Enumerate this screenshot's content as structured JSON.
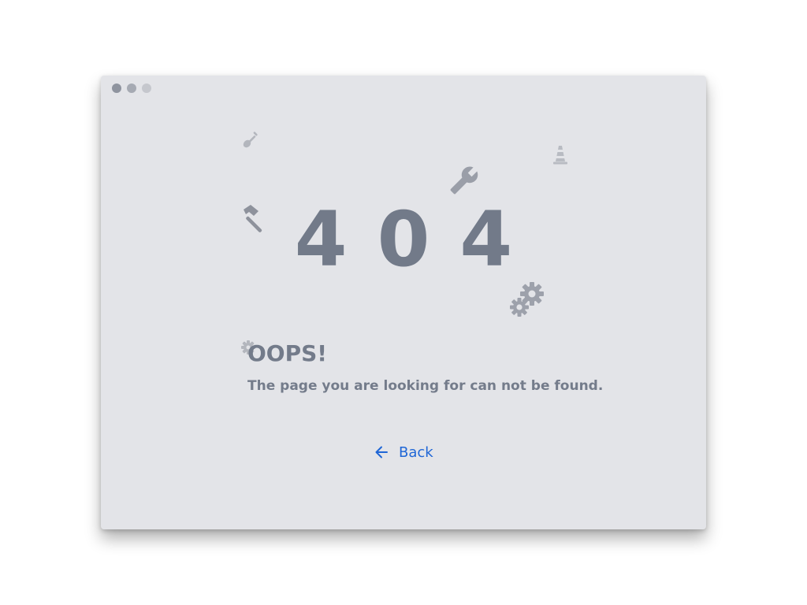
{
  "error": {
    "code": "404",
    "heading": "OOPS!",
    "message": "The page you are looking for can not be found."
  },
  "back": {
    "label": "Back",
    "icon": "arrow-left-icon"
  },
  "window_controls": [
    "dot",
    "dot",
    "dot"
  ],
  "decorations": [
    "shovel-icon",
    "traffic-cone-icon",
    "wrench-icon",
    "hammer-icon",
    "gears-icon",
    "gear-icon"
  ],
  "colors": {
    "window_bg": "#e3e4e8",
    "code": "#727a89",
    "text": "#737b8a",
    "link": "#1f66d6",
    "decoration": "#a7aab3"
  }
}
